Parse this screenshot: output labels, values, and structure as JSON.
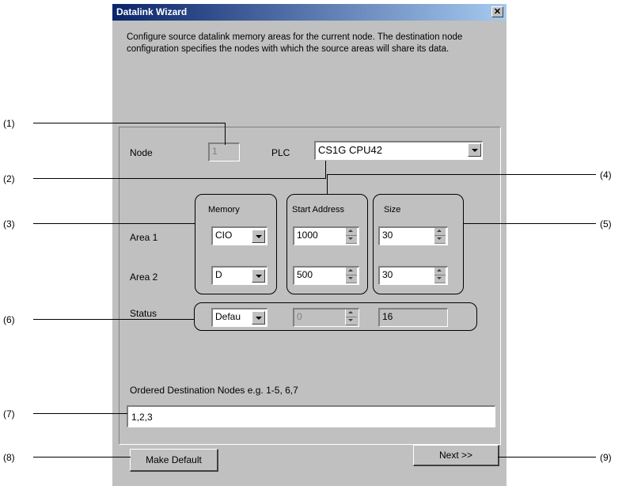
{
  "window": {
    "title": "Datalink Wizard",
    "close_glyph": "✕"
  },
  "intro": "Configure source datalink memory areas for the current node. The destination node configuration specifies the nodes with which the source areas will share its data.",
  "node": {
    "label": "Node",
    "value": "1"
  },
  "plc": {
    "label": "PLC",
    "value": "CS1G CPU42"
  },
  "columns": {
    "memory": "Memory",
    "start_address": "Start Address",
    "size": "Size"
  },
  "area1": {
    "label": "Area 1",
    "memory": "CIO",
    "start_address": "1000",
    "size": "30"
  },
  "area2": {
    "label": "Area 2",
    "memory": "D",
    "start_address": "500",
    "size": "30"
  },
  "status": {
    "label": "Status",
    "memory": "Defau",
    "start_address": "0",
    "size": "16"
  },
  "destination": {
    "label": "Ordered Destination Nodes  e.g. 1-5, 6,7",
    "value": "1,2,3"
  },
  "buttons": {
    "make_default": "Make Default",
    "next": "Next  >>"
  },
  "callouts": [
    "(1)",
    "(2)",
    "(3)",
    "(4)",
    "(5)",
    "(6)",
    "(7)",
    "(8)",
    "(9)"
  ]
}
